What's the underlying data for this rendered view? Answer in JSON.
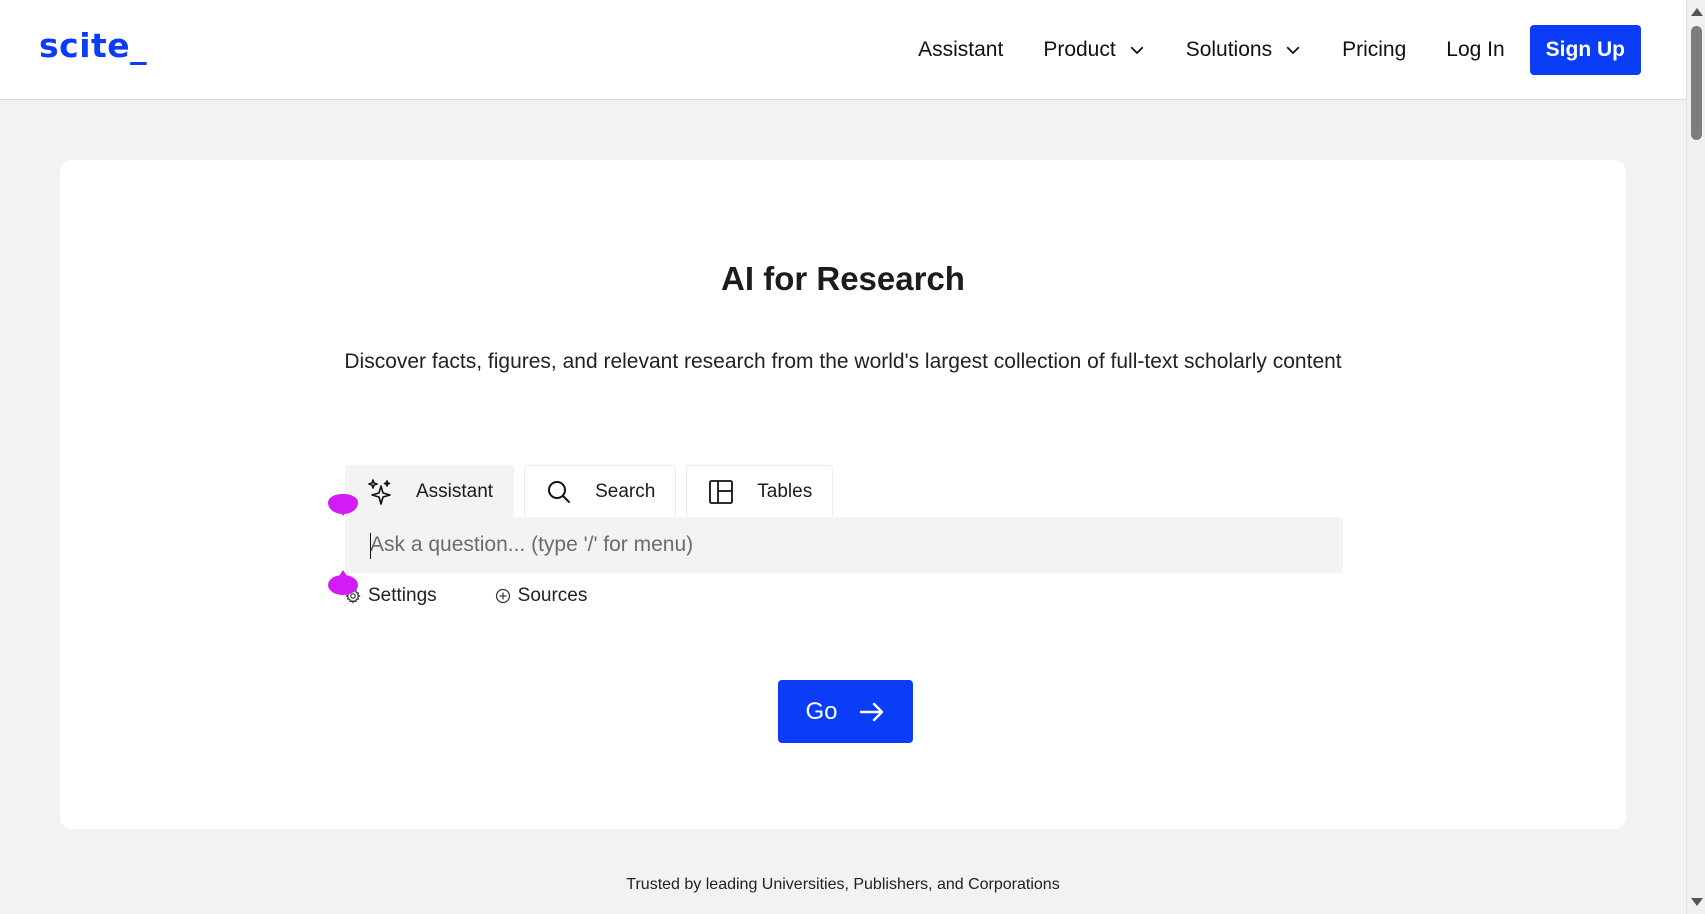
{
  "brand": {
    "logo": "scite_",
    "accent": "#0a3df5"
  },
  "nav": {
    "items": [
      {
        "label": "Assistant",
        "dropdown": false
      },
      {
        "label": "Product",
        "dropdown": true
      },
      {
        "label": "Solutions",
        "dropdown": true
      },
      {
        "label": "Pricing",
        "dropdown": false
      },
      {
        "label": "Log In",
        "dropdown": false
      }
    ],
    "signup_label": "Sign Up"
  },
  "hero": {
    "title": "AI for Research",
    "subtitle": "Discover facts, figures, and relevant research from the world's largest collection of full-text scholarly content"
  },
  "tabs": [
    {
      "label": "Assistant",
      "icon": "sparkles-icon",
      "active": true
    },
    {
      "label": "Search",
      "icon": "search-icon",
      "active": false
    },
    {
      "label": "Tables",
      "icon": "table-icon",
      "active": false
    }
  ],
  "query": {
    "placeholder": "Ask a question... (type '/' for menu)",
    "value": ""
  },
  "options": {
    "settings_label": "Settings",
    "sources_label": "Sources"
  },
  "go_label": "Go",
  "footer": {
    "trusted": "Trusted by leading Universities, Publishers, and Corporations"
  }
}
